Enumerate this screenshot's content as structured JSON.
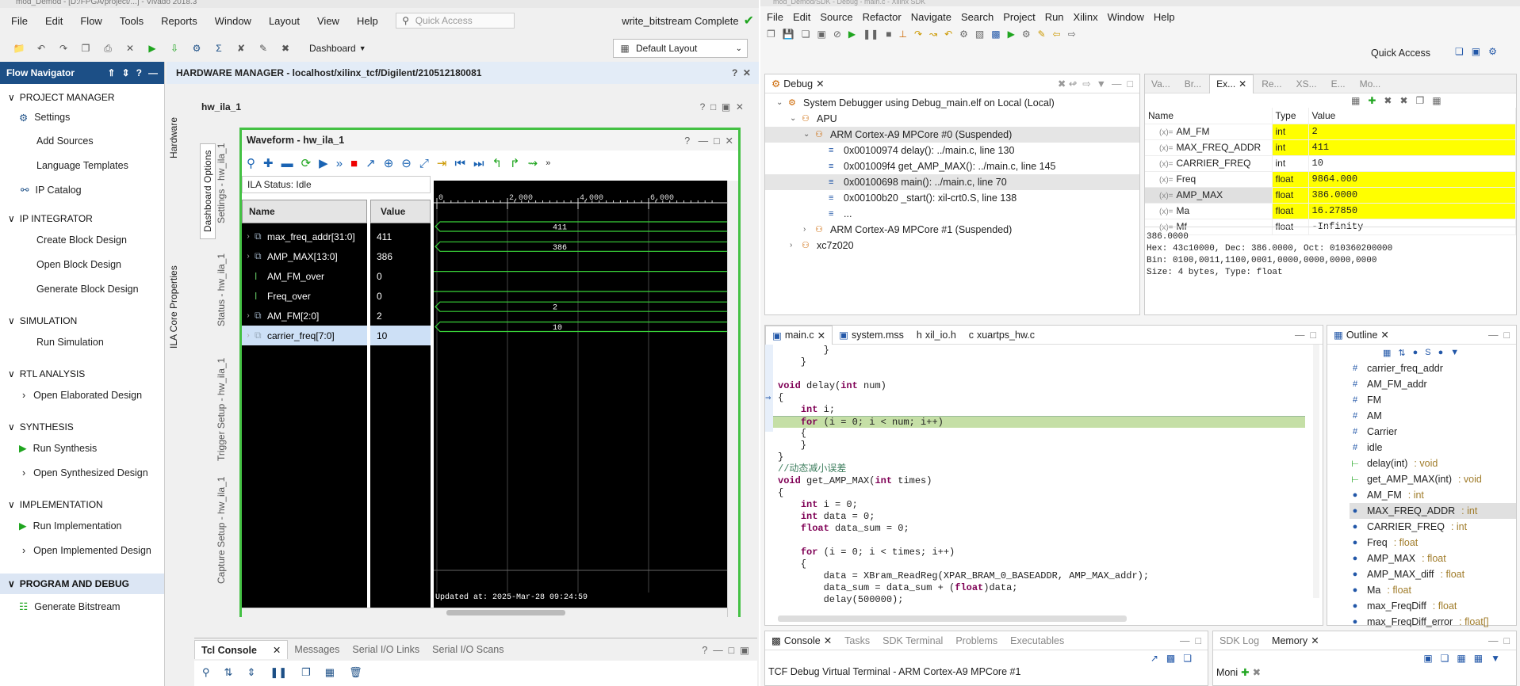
{
  "vivado": {
    "title": "mod_Demod - [D:/FPGA/project/...] - Vivado 2018.3",
    "menu": [
      "File",
      "Edit",
      "Flow",
      "Tools",
      "Reports",
      "Window",
      "Layout",
      "View",
      "Help"
    ],
    "quick_access": "Quick Access",
    "status": "write_bitstream Complete",
    "dashboard": "Dashboard",
    "layout": "Default Layout",
    "flow_nav": {
      "title": "Flow Navigator",
      "sections": [
        {
          "label": "PROJECT MANAGER",
          "items": [
            "Settings",
            "Add Sources",
            "Language Templates",
            "IP Catalog"
          ]
        },
        {
          "label": "IP INTEGRATOR",
          "items": [
            "Create Block Design",
            "Open Block Design",
            "Generate Block Design"
          ]
        },
        {
          "label": "SIMULATION",
          "items": [
            "Run Simulation"
          ]
        },
        {
          "label": "RTL ANALYSIS",
          "items": [
            "Open Elaborated Design"
          ]
        },
        {
          "label": "SYNTHESIS",
          "items": [
            "Run Synthesis",
            "Open Synthesized Design"
          ]
        },
        {
          "label": "IMPLEMENTATION",
          "items": [
            "Run Implementation",
            "Open Implemented Design"
          ]
        },
        {
          "label": "PROGRAM AND DEBUG",
          "items": [
            "Generate Bitstream"
          ]
        }
      ]
    },
    "hw_manager": "HARDWARE MANAGER - localhost/xilinx_tcf/Digilent/210512180081",
    "side_tabs": [
      "Hardware",
      "ILA Core Properties"
    ],
    "ila_title": "hw_ila_1",
    "dash_tabs": [
      "Dashboard Options",
      "Settings - hw_ila_1",
      "Status - hw_ila_1",
      "Trigger Setup - hw_ila_1",
      "Capture Setup - hw_ila_1"
    ],
    "waveform": {
      "title": "Waveform - hw_ila_1",
      "ila_status": "ILA Status:  Idle",
      "col_name": "Name",
      "col_value": "Value",
      "signals": [
        {
          "name": "max_freq_addr[31:0]",
          "value": "411",
          "bus": true,
          "label": "411"
        },
        {
          "name": "AMP_MAX[13:0]",
          "value": "386",
          "bus": true,
          "label": "386"
        },
        {
          "name": "AM_FM_over",
          "value": "0",
          "bus": false,
          "label": ""
        },
        {
          "name": "Freq_over",
          "value": "0",
          "bus": false,
          "label": ""
        },
        {
          "name": "AM_FM[2:0]",
          "value": "2",
          "bus": true,
          "label": "2"
        },
        {
          "name": "carrier_freq[7:0]",
          "value": "10",
          "bus": true,
          "label": "10"
        }
      ],
      "ticks": [
        "0",
        "2,000",
        "4,000",
        "6,000"
      ],
      "updated": "Updated at: 2025-Mar-28 09:24:59"
    },
    "console_tabs": [
      "Tcl Console",
      "Messages",
      "Serial I/O Links",
      "Serial I/O Scans"
    ]
  },
  "sdk": {
    "title": "mod_Demod/SDK - Debug - main.c - Xilinx SDK",
    "menu": [
      "File",
      "Edit",
      "Source",
      "Refactor",
      "Navigate",
      "Search",
      "Project",
      "Run",
      "Xilinx",
      "Window",
      "Help"
    ],
    "quick_access": "Quick Access",
    "debug": {
      "tab": "Debug",
      "tree": [
        {
          "level": 0,
          "text": "System Debugger using Debug_main.elf on Local (Local)"
        },
        {
          "level": 1,
          "text": "APU"
        },
        {
          "level": 2,
          "text": "ARM Cortex-A9 MPCore #0 (Suspended)"
        },
        {
          "level": 3,
          "text": "0x00100974 delay(): ../main.c, line 130"
        },
        {
          "level": 3,
          "text": "0x001009f4 get_AMP_MAX(): ../main.c, line 145"
        },
        {
          "level": 3,
          "text": "0x00100698 main(): ../main.c, line 70"
        },
        {
          "level": 3,
          "text": "0x00100b20 _start(): xil-crt0.S, line 138"
        },
        {
          "level": 3,
          "text": "..."
        },
        {
          "level": 2,
          "text": "ARM Cortex-A9 MPCore #1 (Suspended)"
        },
        {
          "level": 1,
          "text": "xc7z020"
        }
      ]
    },
    "vars": {
      "tabs": [
        "Va...",
        "Br...",
        "Ex...",
        "Re...",
        "XS...",
        "E...",
        "Mo..."
      ],
      "headers": [
        "Name",
        "Type",
        "Value"
      ],
      "rows": [
        {
          "name": "AM_FM",
          "type": "int",
          "value": "2",
          "hl": true
        },
        {
          "name": "MAX_FREQ_ADDR",
          "type": "int",
          "value": "411",
          "hl": true
        },
        {
          "name": "CARRIER_FREQ",
          "type": "int",
          "value": "10",
          "hl": false
        },
        {
          "name": "Freq",
          "type": "float",
          "value": "9864.000",
          "hl": true
        },
        {
          "name": "AMP_MAX",
          "type": "float",
          "value": "386.0000",
          "hl": true
        },
        {
          "name": "Ma",
          "type": "float",
          "value": "16.27850",
          "hl": true
        },
        {
          "name": "Mf",
          "type": "float",
          "value": "-Infinity",
          "hl": false
        }
      ],
      "detail": [
        "386.0000",
        "Hex: 43c10000, Dec: 386.0000, Oct: 010360200000",
        "Bin: 0100,0011,1100,0001,0000,0000,0000,0000",
        "Size: 4 bytes, Type: float"
      ]
    },
    "editor_tabs": [
      "main.c",
      "system.mss",
      "xil_io.h",
      "xuartps_hw.c"
    ],
    "code": [
      "        }",
      "    }",
      "",
      "void delay(int num)",
      "{",
      "    int i;",
      "    for (i = 0; i < num; i++)",
      "    {",
      "    }",
      "}",
      "//动态减小误差",
      "void get_AMP_MAX(int times)",
      "{",
      "    int i = 0;",
      "    int data = 0;",
      "    float data_sum = 0;",
      "",
      "    for (i = 0; i < times; i++)",
      "    {",
      "        data = XBram_ReadReg(XPAR_BRAM_0_BASEADDR, AMP_MAX_addr);",
      "        data_sum = data_sum + (float)data;",
      "        delay(500000);"
    ],
    "outline": {
      "tab": "Outline",
      "items": [
        {
          "icon": "#",
          "name": "carrier_freq_addr",
          "type": ""
        },
        {
          "icon": "#",
          "name": "AM_FM_addr",
          "type": ""
        },
        {
          "icon": "#",
          "name": "FM",
          "type": ""
        },
        {
          "icon": "#",
          "name": "AM",
          "type": ""
        },
        {
          "icon": "#",
          "name": "Carrier",
          "type": ""
        },
        {
          "icon": "#",
          "name": "idle",
          "type": ""
        },
        {
          "icon": "f",
          "name": "delay(int)",
          "type": " : void"
        },
        {
          "icon": "f",
          "name": "get_AMP_MAX(int)",
          "type": " : void"
        },
        {
          "icon": "v",
          "name": "AM_FM",
          "type": " : int"
        },
        {
          "icon": "v",
          "name": "MAX_FREQ_ADDR",
          "type": " : int"
        },
        {
          "icon": "v",
          "name": "CARRIER_FREQ",
          "type": " : int"
        },
        {
          "icon": "v",
          "name": "Freq",
          "type": " : float"
        },
        {
          "icon": "v",
          "name": "AMP_MAX",
          "type": " : float"
        },
        {
          "icon": "v",
          "name": "AMP_MAX_diff",
          "type": " : float"
        },
        {
          "icon": "v",
          "name": "Ma",
          "type": " : float"
        },
        {
          "icon": "v",
          "name": "max_FreqDiff",
          "type": " : float"
        },
        {
          "icon": "v",
          "name": "max_FreqDiff_error",
          "type": " : float[]"
        }
      ]
    },
    "console_tabs": [
      "Console",
      "Tasks",
      "SDK Terminal",
      "Problems",
      "Executables"
    ],
    "log_tabs": [
      "SDK Log",
      "Memory"
    ],
    "console_text": "TCF Debug Virtual Terminal - ARM Cortex-A9 MPCore #1",
    "monitor_label": "Moni"
  }
}
